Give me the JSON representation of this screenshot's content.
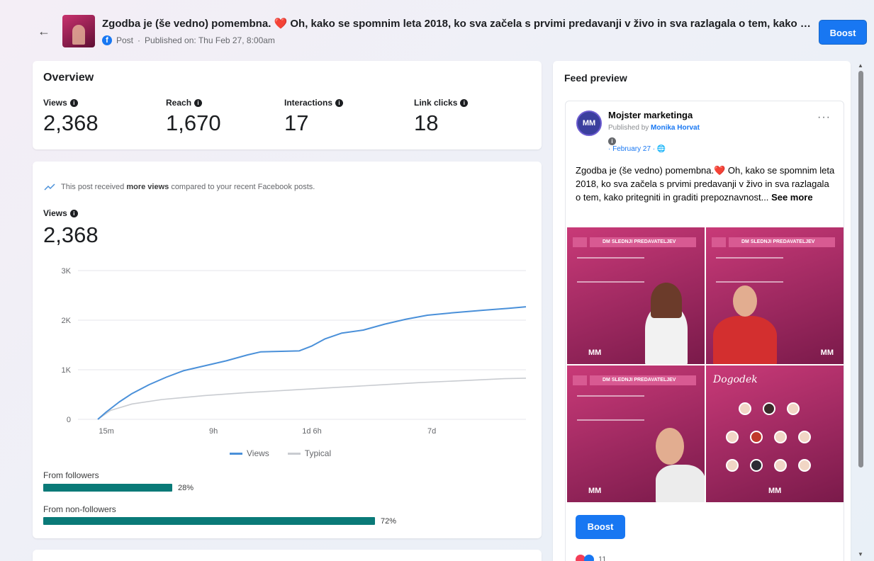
{
  "header": {
    "back_icon": "arrow-left-icon",
    "title": "Zgodba je (še vedno) pomembna. ❤️ Oh, kako se spomnim leta 2018, ko sva začela s prvimi predavanji v živo in sva razlagala o tem, kako p...",
    "post_type": "Post",
    "published": "Published on: Thu Feb 27, 8:00am",
    "boost_label": "Boost"
  },
  "overview": {
    "title": "Overview",
    "metrics": [
      {
        "label": "Views",
        "value": "2,368"
      },
      {
        "label": "Reach",
        "value": "1,670"
      },
      {
        "label": "Interactions",
        "value": "17"
      },
      {
        "label": "Link clicks",
        "value": "18"
      }
    ]
  },
  "views_card": {
    "trend_prefix": "This post received",
    "trend_bold": "more views",
    "trend_suffix": "compared to your recent Facebook posts.",
    "views_label": "Views",
    "views_value": "2,368",
    "legend_views": "Views",
    "legend_typical": "Typical",
    "followers_label": "From followers",
    "followers_pct": "28%",
    "followers_value": 0.28,
    "nonfollowers_label": "From non-followers",
    "nonfollowers_pct": "72%",
    "nonfollowers_value": 0.72
  },
  "chart_data": {
    "type": "line",
    "title": "",
    "xlabel": "",
    "ylabel": "",
    "ylim": [
      0,
      3000
    ],
    "yticks": [
      0,
      1000,
      2000,
      3000
    ],
    "ytick_labels": [
      "0",
      "1K",
      "2K",
      "3K"
    ],
    "xticks": [
      0.02,
      0.27,
      0.5,
      0.78
    ],
    "xtick_labels": [
      "15m",
      "9h",
      "1d 6h",
      "7d"
    ],
    "grid": true,
    "legend": "bottom",
    "series": [
      {
        "name": "Views",
        "color": "#4a90d9",
        "x": [
          0,
          0.02,
          0.05,
          0.08,
          0.12,
          0.16,
          0.2,
          0.25,
          0.3,
          0.35,
          0.38,
          0.42,
          0.47,
          0.5,
          0.53,
          0.57,
          0.62,
          0.67,
          0.72,
          0.77,
          0.83,
          0.9,
          0.96,
          1.0
        ],
        "values": [
          0,
          150,
          350,
          520,
          700,
          850,
          980,
          1080,
          1180,
          1300,
          1360,
          1370,
          1380,
          1480,
          1620,
          1740,
          1800,
          1920,
          2020,
          2100,
          2150,
          2200,
          2240,
          2270
        ]
      },
      {
        "name": "Typical",
        "color": "#c9ccd1",
        "x": [
          0,
          0.03,
          0.08,
          0.15,
          0.25,
          0.35,
          0.45,
          0.55,
          0.65,
          0.75,
          0.85,
          0.95,
          1.0
        ],
        "values": [
          0,
          180,
          310,
          400,
          480,
          540,
          590,
          640,
          690,
          740,
          780,
          820,
          830
        ]
      }
    ]
  },
  "feed_preview": {
    "title": "Feed preview",
    "page_name": "Mojster marketinga",
    "published_by_prefix": "Published by",
    "published_by_name": "Monika Horvat",
    "date": "· February 27 · 🌐",
    "more_icon": "more-horizontal-icon",
    "text": "Zgodba je (še vedno) pomembna.❤️ Oh, kako se spomnim leta 2018, ko sva začela s prvimi predavanji v živo in sva razlagala o tem, kako pritegniti in graditi prepoznavnost...",
    "see_more": "See more",
    "tile_band": "DM  SLEDNJI PREDAVATELJEV",
    "tile4_title": "Dogodek",
    "logo_text": "MM",
    "boost_label": "Boost",
    "reaction_count": "11"
  }
}
